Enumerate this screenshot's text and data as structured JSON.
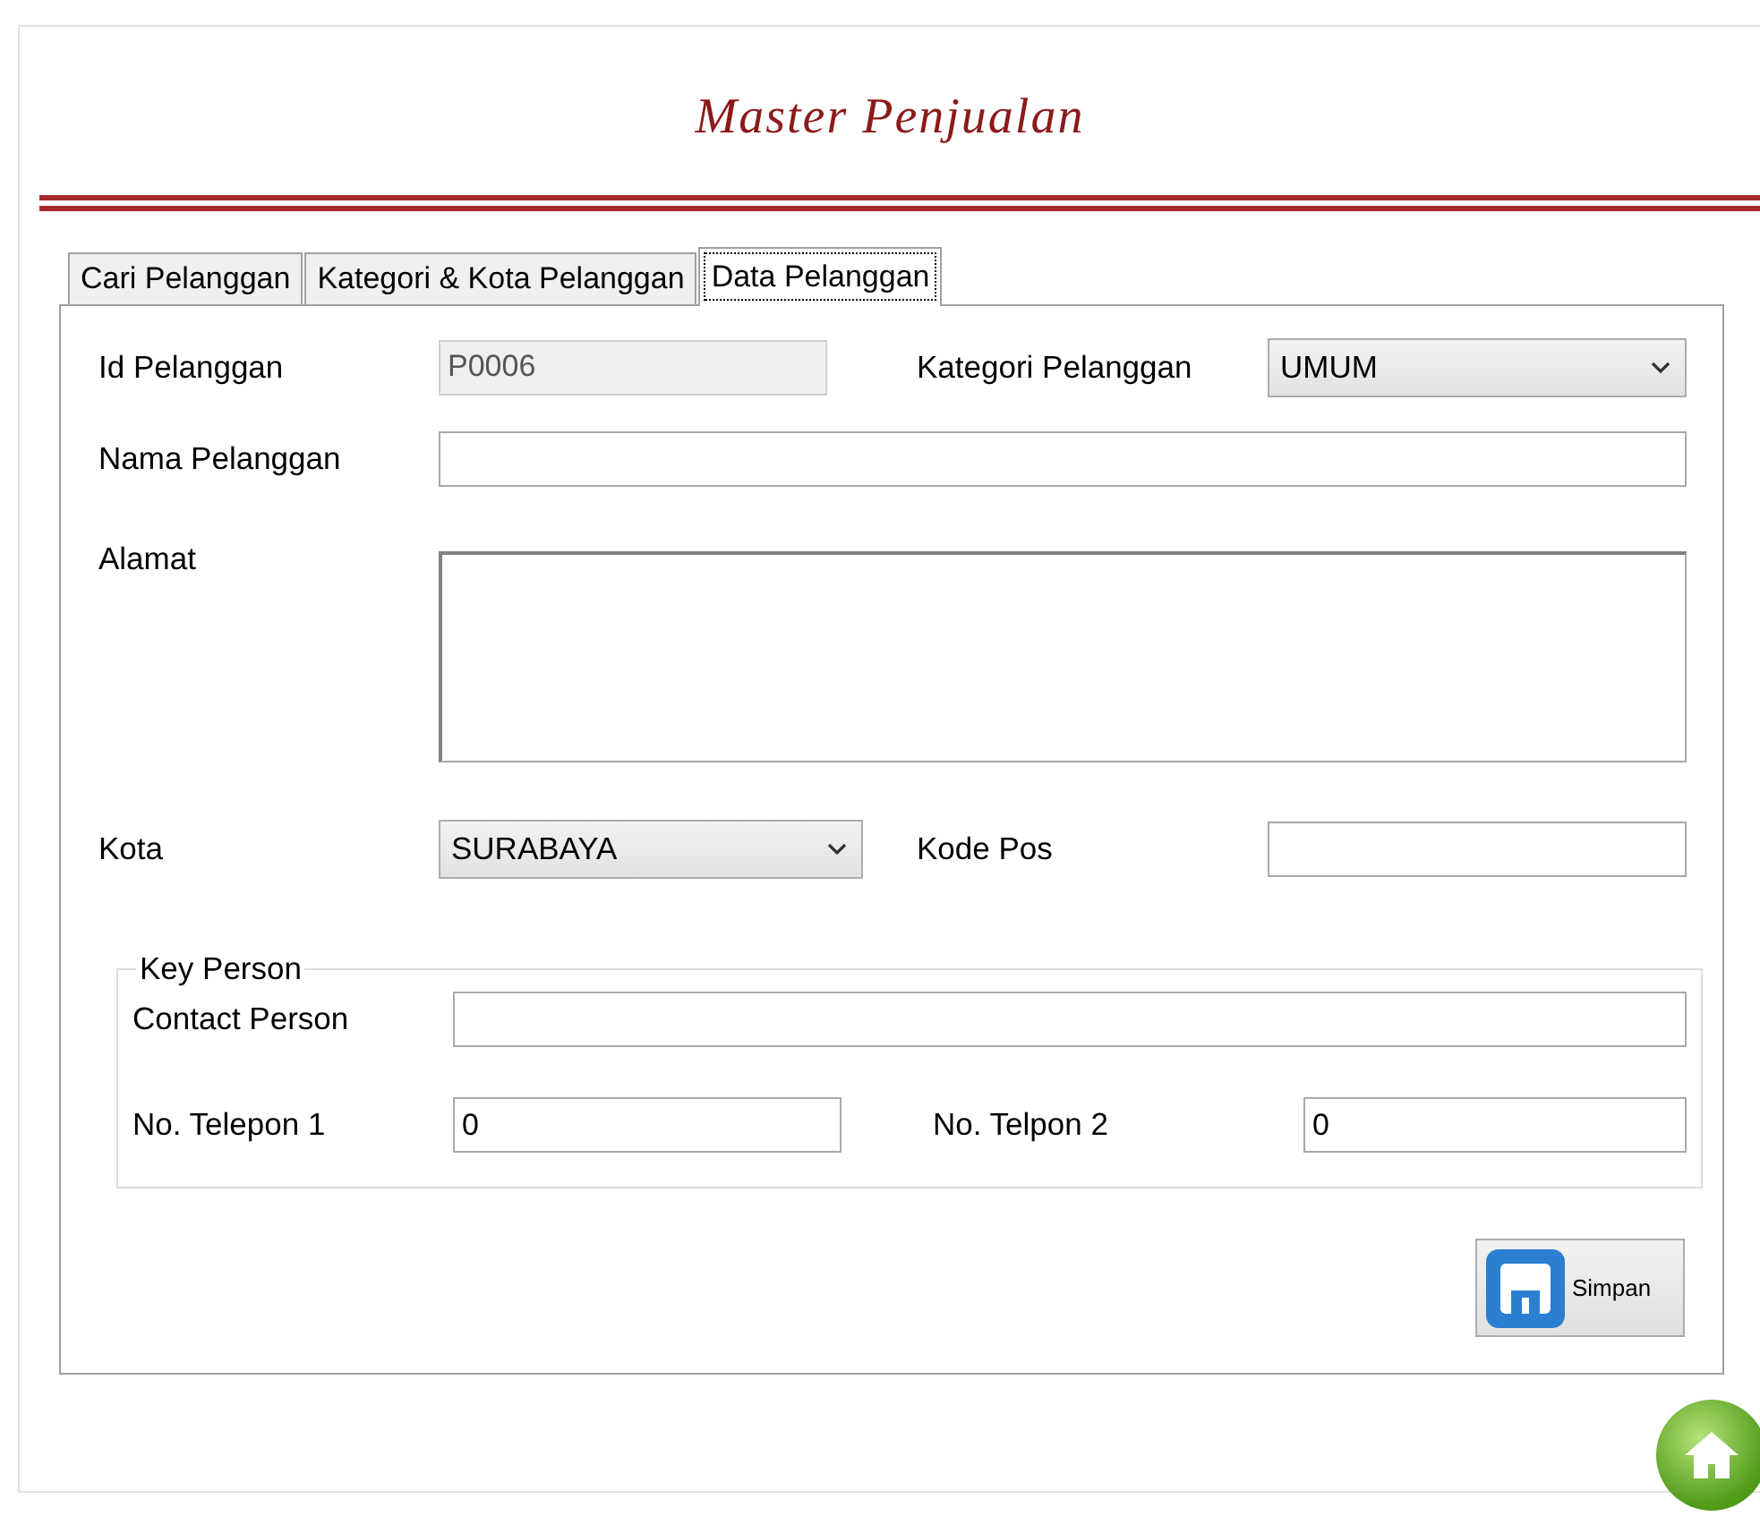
{
  "title": "Master Penjualan",
  "tabs": [
    {
      "label": "Cari Pelanggan",
      "selected": false
    },
    {
      "label": "Kategori & Kota Pelanggan",
      "selected": false
    },
    {
      "label": "Data Pelanggan",
      "selected": true
    }
  ],
  "form": {
    "id": {
      "label": "Id Pelanggan",
      "value": "P0006",
      "disabled": true
    },
    "kategori": {
      "label": "Kategori Pelanggan",
      "value": "UMUM"
    },
    "nama": {
      "label": "Nama Pelanggan"
    },
    "alamat": {
      "label": "Alamat"
    },
    "kota": {
      "label": "Kota",
      "value": "SURABAYA"
    },
    "kode_pos": {
      "label": "Kode Pos"
    }
  },
  "key_person": {
    "legend": "Key Person",
    "contact": {
      "label": "Contact Person"
    },
    "telepon1": {
      "label": "No. Telepon 1",
      "value": "0"
    },
    "telepon2": {
      "label": "No. Telpon 2",
      "value": "0"
    }
  },
  "save_button": {
    "label": "Simpan"
  }
}
